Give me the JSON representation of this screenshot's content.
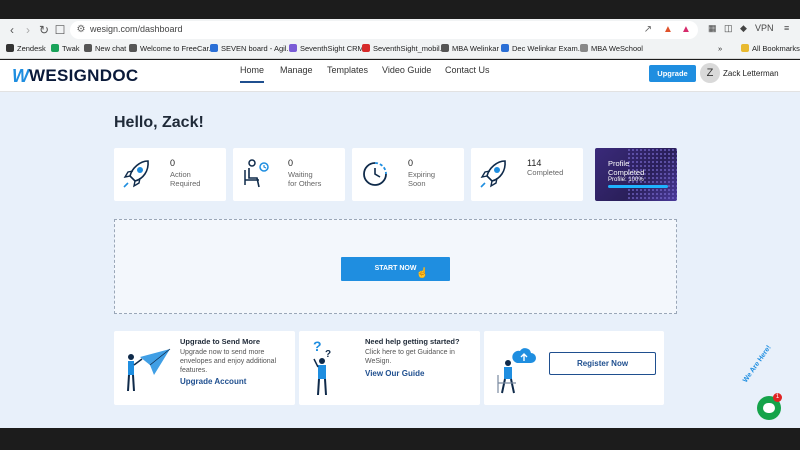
{
  "browser": {
    "url": "wesign.com/dashboard",
    "bookmarks": [
      {
        "label": "Zendesk",
        "color": "#333"
      },
      {
        "label": "Twak",
        "color": "#1aa35a"
      },
      {
        "label": "New chat",
        "color": "#555"
      },
      {
        "label": "Welcome to FreeCar...",
        "color": "#555"
      },
      {
        "label": "SEVEN board - Agil...",
        "color": "#2b6fd6"
      },
      {
        "label": "SeventhSight CRM",
        "color": "#7a5cd6"
      },
      {
        "label": "SeventhSight_mobil...",
        "color": "#d62b2b"
      },
      {
        "label": "MBA Welinkar",
        "color": "#555"
      },
      {
        "label": "Dec Welinkar Exam...",
        "color": "#2b6fd6"
      },
      {
        "label": "MBA WeSchool",
        "color": "#888"
      }
    ],
    "all_bookmarks": "All Bookmarks",
    "vpn": "VPN"
  },
  "header": {
    "logo_mark": "W",
    "logo_text": "WESIGNDOC",
    "nav": [
      "Home",
      "Manage",
      "Templates",
      "Video Guide",
      "Contact Us"
    ],
    "upgrade_label": "Upgrade",
    "avatar_initial": "Z",
    "user_name": "Zack Letterman"
  },
  "greeting": "Hello, Zack!",
  "stats": [
    {
      "value": "0",
      "label1": "Action",
      "label2": "Required",
      "icon": "rocket-icon"
    },
    {
      "value": "0",
      "label1": "Waiting",
      "label2": "for Others",
      "icon": "waiting-person-icon"
    },
    {
      "value": "0",
      "label1": "Expiring",
      "label2": "Soon",
      "icon": "clock-icon"
    },
    {
      "value": "114",
      "label1": "Completed",
      "label2": "",
      "icon": "rocket-icon"
    }
  ],
  "profile": {
    "title1": "Profile",
    "title2": "Completed",
    "progress_text": "Profile: 100%",
    "progress": 1.0
  },
  "start_label": "START NOW",
  "cards": {
    "upgrade": {
      "title": "Upgrade to Send More",
      "desc": [
        "Upgrade now to send more",
        "envelopes and enjoy additional",
        "features."
      ],
      "link": "Upgrade Account"
    },
    "help": {
      "title": "Need help getting started?",
      "desc": [
        "Click here to get Guidance in",
        "WeSign."
      ],
      "link": "View Our Guide"
    },
    "register": {
      "button": "Register Now"
    }
  },
  "chat": {
    "badge": "1",
    "text": "We Are Here!"
  },
  "colors": {
    "accent": "#1f8ee0",
    "navy": "#1f4f8f",
    "page_bg": "#e8f0fa"
  }
}
